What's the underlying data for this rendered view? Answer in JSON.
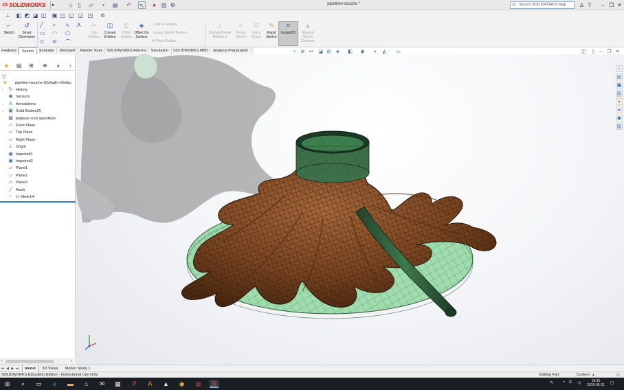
{
  "app": {
    "brand": "SOLIDWORKS",
    "brand_prefix": "3S",
    "document_title": "pipeline+souche *",
    "help_search_placeholder": "Search SOLIDWORKS Help"
  },
  "ribbon": {
    "commands": [
      {
        "label": "Sketch",
        "icon": "sketch-icon"
      },
      {
        "label": "Smart Dimension",
        "icon": "smart-dimension-icon"
      },
      {
        "label": "Trim Entities",
        "icon": "trim-icon",
        "enabled": false
      },
      {
        "label": "Convert Entities",
        "icon": "convert-icon"
      },
      {
        "label": "Offset Entities",
        "icon": "offset-icon",
        "enabled": false
      },
      {
        "label": "Offset On Surface",
        "icon": "offset-surface-icon"
      },
      {
        "label": "Mirror Entities",
        "icon": "mirror-icon",
        "enabled": false
      },
      {
        "label": "Linear Sketch Pattern",
        "icon": "linear-pattern-icon",
        "enabled": false
      },
      {
        "label": "Move Entities",
        "icon": "move-icon",
        "enabled": false
      },
      {
        "label": "Display/Delete Relations",
        "icon": "relations-icon",
        "enabled": false
      },
      {
        "label": "Repair Sketch",
        "icon": "repair-icon",
        "enabled": false
      },
      {
        "label": "Quick Snaps",
        "icon": "snaps-icon",
        "enabled": false
      },
      {
        "label": "Rapid Sketch",
        "icon": "rapid-sketch-icon"
      },
      {
        "label": "Instant2D",
        "icon": "instant2d-icon",
        "active": true
      },
      {
        "label": "Shaded Sketch Contours",
        "icon": "shaded-contours-icon",
        "enabled": false
      }
    ]
  },
  "tabs": [
    "Features",
    "Sketch",
    "Evaluate",
    "DimXpert",
    "Render Tools",
    "SOLIDWORKS Add-Ins",
    "Simulation",
    "SOLIDWORKS MBD",
    "Analysis Preparation"
  ],
  "active_tab": "Sketch",
  "tree": {
    "root": {
      "label": "pipeline+souche  (Default<<Defau"
    },
    "items": [
      {
        "label": "History",
        "icon": "history-icon",
        "expandable": true
      },
      {
        "label": "Sensors",
        "icon": "sensors-icon",
        "expandable": false
      },
      {
        "label": "Annotations",
        "icon": "annotations-icon",
        "expandable": true
      },
      {
        "label": "Solid Bodies(2)",
        "icon": "solid-bodies-icon",
        "expandable": true
      },
      {
        "label": "Material <not specified>",
        "icon": "material-icon",
        "expandable": false
      },
      {
        "label": "Front Plane",
        "icon": "plane-icon",
        "expandable": false
      },
      {
        "label": "Top Plane",
        "icon": "plane-icon",
        "expandable": false
      },
      {
        "label": "Right Plane",
        "icon": "plane-icon",
        "expandable": false
      },
      {
        "label": "Origin",
        "icon": "origin-icon",
        "expandable": false
      },
      {
        "label": "Imported1",
        "icon": "imported-icon",
        "expandable": false
      },
      {
        "label": "Imported2",
        "icon": "imported-icon",
        "expandable": false
      },
      {
        "label": "Plane1",
        "icon": "plane-icon",
        "expandable": false
      },
      {
        "label": "Plane2",
        "icon": "plane-icon",
        "expandable": false
      },
      {
        "label": "Plane3",
        "icon": "plane-icon",
        "expandable": false
      },
      {
        "label": "Axis1",
        "icon": "axis-icon",
        "expandable": false
      },
      {
        "label": "(-) Sketch4",
        "icon": "sketch-icon",
        "expandable": false
      }
    ]
  },
  "model_tabs": [
    "Model",
    "3D Views",
    "Motion Study 1"
  ],
  "active_model_tab": "Model",
  "status": {
    "left": "SOLIDWORKS Education Edition - Instructional Use Only",
    "mode": "Editing Part",
    "units": "Custom"
  },
  "taskbar": {
    "time": "18:30",
    "date": "2019-05-21"
  },
  "colors": {
    "brand_red": "#c8201e",
    "accent_blue": "#2b5ea8",
    "stump_brown": "#7a4420",
    "base_green": "#9fdcae",
    "mesh_dark": "#1d1208",
    "taskbar": "#1b1f24"
  }
}
